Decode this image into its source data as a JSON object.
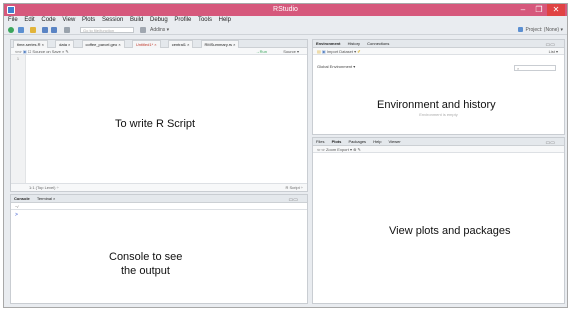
{
  "window": {
    "title": "RStudio",
    "min_glyph": "–",
    "max_glyph": "❐",
    "close_glyph": "✕"
  },
  "menu": [
    "File",
    "Edit",
    "Code",
    "View",
    "Plots",
    "Session",
    "Build",
    "Debug",
    "Profile",
    "Tools",
    "Help"
  ],
  "toolbar": {
    "goto_placeholder": "Go to file/function",
    "addins_label": "Addins ▾",
    "project_label": "Project: (None) ▾"
  },
  "source": {
    "tabs": [
      "time-series.R ×",
      "data ×",
      "coffee_parcel.geo ×",
      "Untitled1* ×",
      "central1 ×",
      "RMSummary.rs ×"
    ],
    "save_on_source": "Source on Save",
    "run_label": "→Run",
    "source_label": "Source ▾",
    "line_number": "1",
    "status_left": "1:1    (Top Level) ÷",
    "status_right": "R Script ÷",
    "label": "To write R Script"
  },
  "environment": {
    "tabs": [
      "Environment",
      "History",
      "Connections"
    ],
    "import_label": "Import Dataset ▾",
    "list_label": "List ▾",
    "global_env": "Global Environment ▾",
    "empty_text": "Environment is empty",
    "label": "Environment and history"
  },
  "console": {
    "tabs": [
      "Console",
      "Terminal ×"
    ],
    "path": "~/",
    "prompt": ">",
    "label_line1": "Console to see",
    "label_line2": "the output"
  },
  "files": {
    "tabs": [
      "Files",
      "Plots",
      "Packages",
      "Help",
      "Viewer"
    ],
    "tools_text": "Zoom   Export ▾",
    "label": "View plots and packages"
  }
}
